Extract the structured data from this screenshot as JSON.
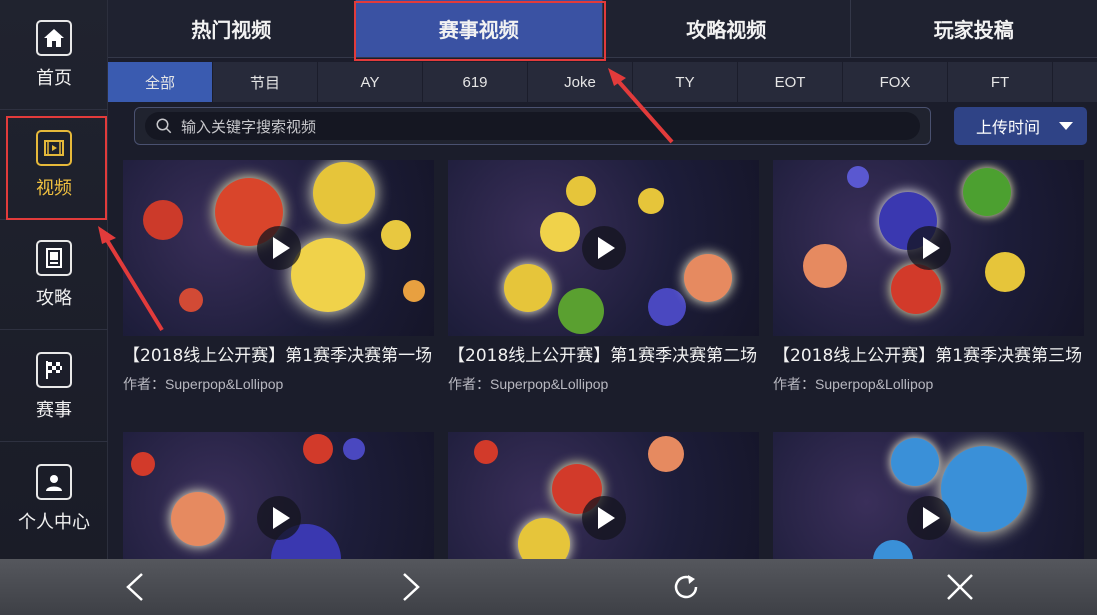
{
  "sidebar": {
    "items": [
      {
        "label": "首页",
        "icon": "home-icon"
      },
      {
        "label": "视频",
        "icon": "video-icon",
        "active": true
      },
      {
        "label": "攻略",
        "icon": "book-icon"
      },
      {
        "label": "赛事",
        "icon": "checkered-flag-icon"
      },
      {
        "label": "个人中心",
        "icon": "user-icon"
      }
    ]
  },
  "top_tabs": [
    {
      "label": "热门视频"
    },
    {
      "label": "赛事视频",
      "active": true
    },
    {
      "label": "攻略视频"
    },
    {
      "label": "玩家投稿"
    }
  ],
  "sub_tabs": [
    {
      "label": "全部",
      "active": true
    },
    {
      "label": "节目"
    },
    {
      "label": "AY"
    },
    {
      "label": "619"
    },
    {
      "label": "Joke"
    },
    {
      "label": "TY"
    },
    {
      "label": "EOT"
    },
    {
      "label": "FOX"
    },
    {
      "label": "FT"
    },
    {
      "label": ""
    }
  ],
  "search": {
    "placeholder": "输入关键字搜索视频"
  },
  "sort": {
    "label": "上传时间"
  },
  "videos": [
    {
      "title": "【2018线上公开赛】第1赛季决赛第一场",
      "author": "作者：Superpop&Lollipop"
    },
    {
      "title": "【2018线上公开赛】第1赛季决赛第二场",
      "author": "作者：Superpop&Lollipop"
    },
    {
      "title": "【2018线上公开赛】第1赛季决赛第三场",
      "author": "作者：Superpop&Lollipop"
    },
    {
      "title": "",
      "author": ""
    },
    {
      "title": "",
      "author": ""
    },
    {
      "title": "",
      "author": ""
    }
  ],
  "bottom_nav": [
    "back-arrow-icon",
    "forward-arrow-icon",
    "refresh-icon",
    "close-icon"
  ],
  "colors": {
    "accent": "#3a52a3",
    "highlight": "#e23b3b",
    "active_text": "#f0c040"
  }
}
